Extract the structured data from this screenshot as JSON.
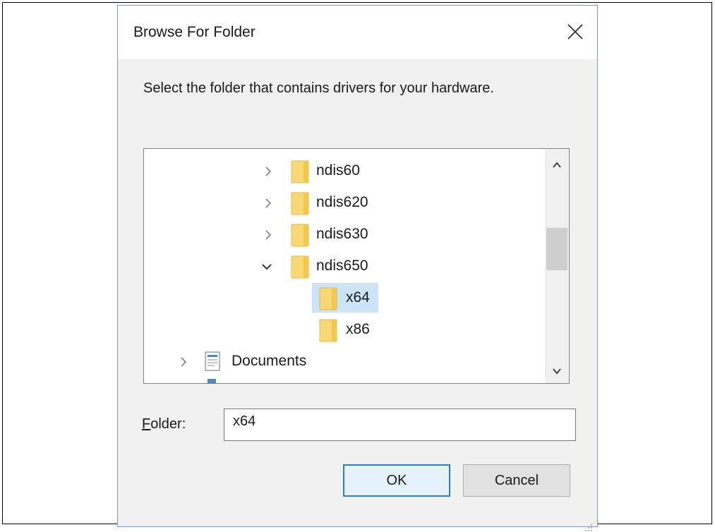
{
  "dialog": {
    "title": "Browse For Folder",
    "instruction": "Select the folder that contains drivers for your hardware."
  },
  "tree": {
    "items": [
      {
        "label": "ndis60",
        "expanded": false,
        "has_children": true,
        "icon": "folder-icon"
      },
      {
        "label": "ndis620",
        "expanded": false,
        "has_children": true,
        "icon": "folder-icon"
      },
      {
        "label": "ndis630",
        "expanded": false,
        "has_children": true,
        "icon": "folder-icon"
      },
      {
        "label": "ndis650",
        "expanded": true,
        "has_children": true,
        "icon": "folder-icon"
      },
      {
        "label": "x64",
        "expanded": false,
        "has_children": false,
        "icon": "folder-icon",
        "selected": true
      },
      {
        "label": "x86",
        "expanded": false,
        "has_children": false,
        "icon": "folder-icon"
      },
      {
        "label": "Documents",
        "expanded": false,
        "has_children": true,
        "icon": "documents-icon"
      }
    ]
  },
  "folder_field": {
    "label": "Folder:",
    "value": "x64"
  },
  "buttons": {
    "ok": "OK",
    "cancel": "Cancel"
  },
  "colors": {
    "dialog_bg": "#f0f0f0",
    "selection": "#cce4f7",
    "accent": "#2b7cd3",
    "folder": "#f8d775"
  }
}
